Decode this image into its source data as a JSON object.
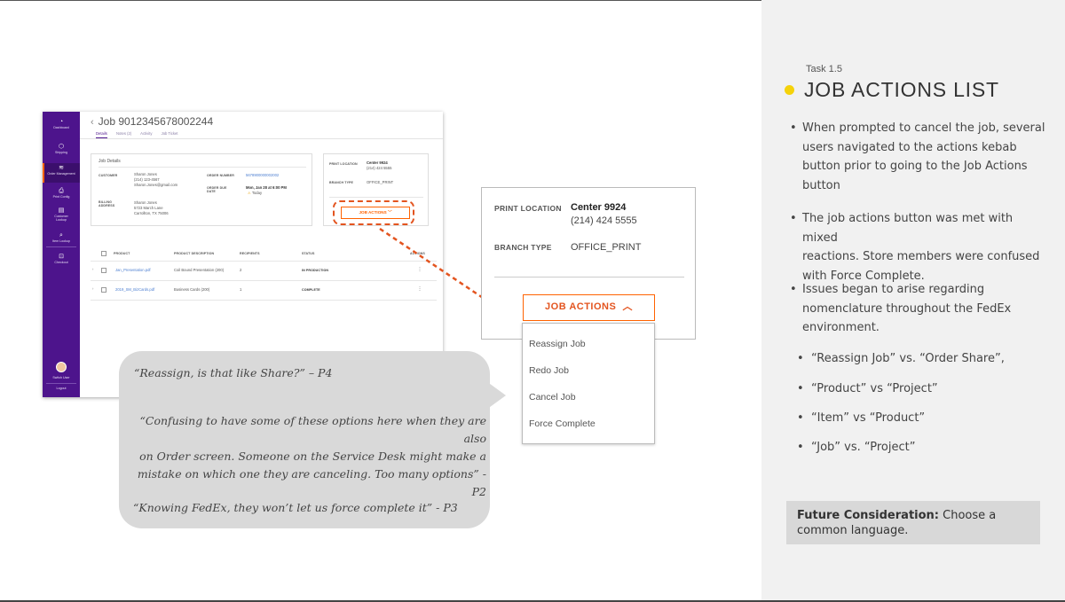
{
  "app": {
    "job_title": "Job 9012345678002244",
    "tabs": [
      "Details",
      "Notes (2)",
      "Activity",
      "Job Ticket"
    ],
    "sidebar": [
      "Dashboard",
      "Shipping",
      "Order Management",
      "Print Config",
      "Customer Lookup",
      "Item Lookup",
      "Checkout",
      "Switch User",
      "Logout"
    ],
    "details": {
      "heading": "Job Details",
      "customer_label": "CUSTOMER",
      "customer_name": "Sharon Jones",
      "customer_phone": "(214) 123-4567",
      "customer_email": "Sharon.Jones@gmail.com",
      "order_number_label": "ORDER NUMBER",
      "order_number": "5678900000002002",
      "order_due_label": "ORDER DUE DATE",
      "order_due": "Mon, Jan 28 at 6:00 PM",
      "order_due_note": "Today",
      "billing_label": "BILLING ADDRESS",
      "billing_name": "Sharon Jones",
      "billing_street": "5723 March Lane",
      "billing_city": "Carrollton, TX 75006"
    },
    "location": {
      "print_location_label": "PRINT LOCATION",
      "print_location": "Center 9924",
      "phone": "(214) 424 5555",
      "branch_type_label": "BRANCH TYPE",
      "branch_type": "OFFICE_PRINT",
      "job_actions_label": "JOB ACTIONS"
    },
    "table": {
      "headers": [
        "PRODUCT",
        "PRODUCT DESCRIPTION",
        "RECIPIENTS",
        "STATUS",
        "ACTIONS"
      ],
      "rows": [
        {
          "product": "Jan_Presentation.pdf",
          "description": "Coil Bound Presentation (200)",
          "recipients": "2",
          "status": "IN PRODUCTION"
        },
        {
          "product": "2019_SM_BizCards.pdf",
          "description": "Business Cards (200)",
          "recipients": "1",
          "status": "COMPLETE"
        }
      ]
    }
  },
  "zoom": {
    "print_location_label": "PRINT LOCATION",
    "print_location": "Center 9924",
    "phone": "(214) 424 5555",
    "branch_type_label": "BRANCH TYPE",
    "branch_type": "OFFICE_PRINT",
    "job_actions_label": "JOB ACTIONS",
    "menu": [
      "Reassign Job",
      "Redo Job",
      "Cancel Job",
      "Force Complete"
    ]
  },
  "quotes": [
    "“Reassign, is that like Share?” – P4",
    "“Confusing to have some of these options here when they are also",
    "on Order screen. Someone on the Service Desk might make a",
    "mistake on which one they are canceling. Too many options” - P2",
    "“Knowing FedEx, they won’t let us force complete it” - P3"
  ],
  "panel": {
    "task": "Task 1.5",
    "title": "JOB ACTIONS LIST",
    "bullets": [
      [
        "When prompted to cancel the job, several",
        "users navigated to the actions kebab",
        "button prior to going to the Job Actions",
        "button"
      ],
      [
        "The job actions button was met with mixed",
        "reactions.  Store members were confused",
        "with Force Complete."
      ],
      [
        "Issues began to arise regarding",
        "nomenclature throughout the FedEx",
        "environment."
      ]
    ],
    "sub_bullets": [
      "“Reassign Job” vs. “Order Share”,",
      "“Product” vs “Project”",
      "“Item” vs “Product”",
      "“Job” vs. “Project”"
    ],
    "future_label": "Future Consideration:",
    "future_text": " Choose a common language."
  },
  "colors": {
    "fedex_purple": "#4d148c",
    "fedex_orange": "#ff6200",
    "highlight_dot": "#f5d20a"
  }
}
